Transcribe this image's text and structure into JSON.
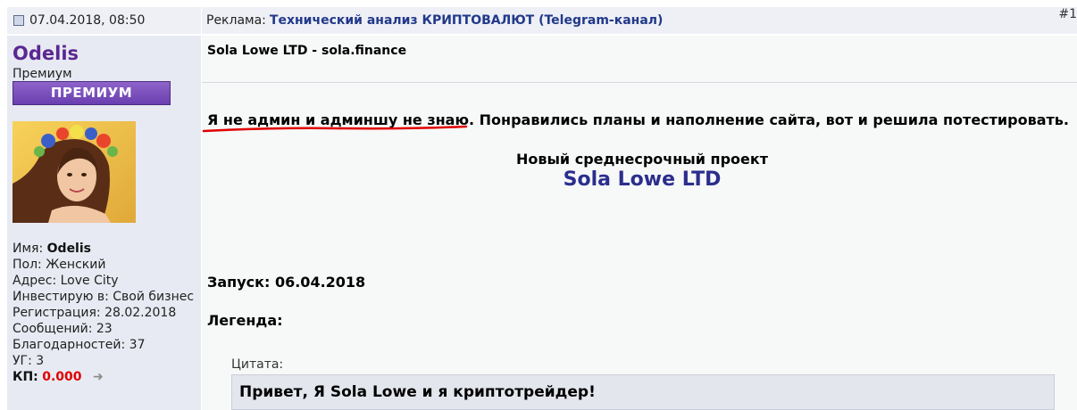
{
  "post": {
    "date": "07.04.2018, 08:50",
    "ad_label": "Реклама:",
    "ad_link": "Технический анализ КРИПТОВАЛЮТ (Telegram-канал)",
    "post_number": "#1"
  },
  "user": {
    "name": "Odelis",
    "title": "Премиум",
    "rank_banner": "ПРЕМИУМ",
    "info": [
      {
        "label": "Имя:",
        "value": "Odelis"
      },
      {
        "label": "Пол:",
        "value": "Женский"
      },
      {
        "label": "Адрес:",
        "value": "Love City"
      },
      {
        "label": "Инвестирую в:",
        "value": "Свой бизнес"
      },
      {
        "label": "Регистрация:",
        "value": "28.02.2018"
      },
      {
        "label": "Сообщений:",
        "value": "23"
      },
      {
        "label": "Благодарностей:",
        "value": "37"
      },
      {
        "label": "УГ:",
        "value": "3"
      }
    ],
    "kp_label": "КП:",
    "kp_value": "0.000"
  },
  "content": {
    "subject": "Sola Lowe LTD - sola.finance",
    "intro_underlined": "Я не админ и админшу не знаю.",
    "intro_rest": " Понравились планы и наполнение сайта, вот и решила потестировать.",
    "project_caption": "Новый среднесрочный проект",
    "project_name": "Sola Lowe LTD",
    "launch": "Запуск: 06.04.2018",
    "legend": "Легенда:",
    "quote_title": "Цитата:",
    "quote_text": "Привет, Я Sola Lowe и я криптотрейдер!"
  },
  "colors": {
    "username": "#5b2791",
    "link": "#22398a",
    "project_name": "#2b2e8c",
    "kp_value": "#e00000",
    "underline": "#e00000"
  },
  "icons": [
    "document-icon",
    "smiley-icon",
    "arrow-right-icon"
  ]
}
